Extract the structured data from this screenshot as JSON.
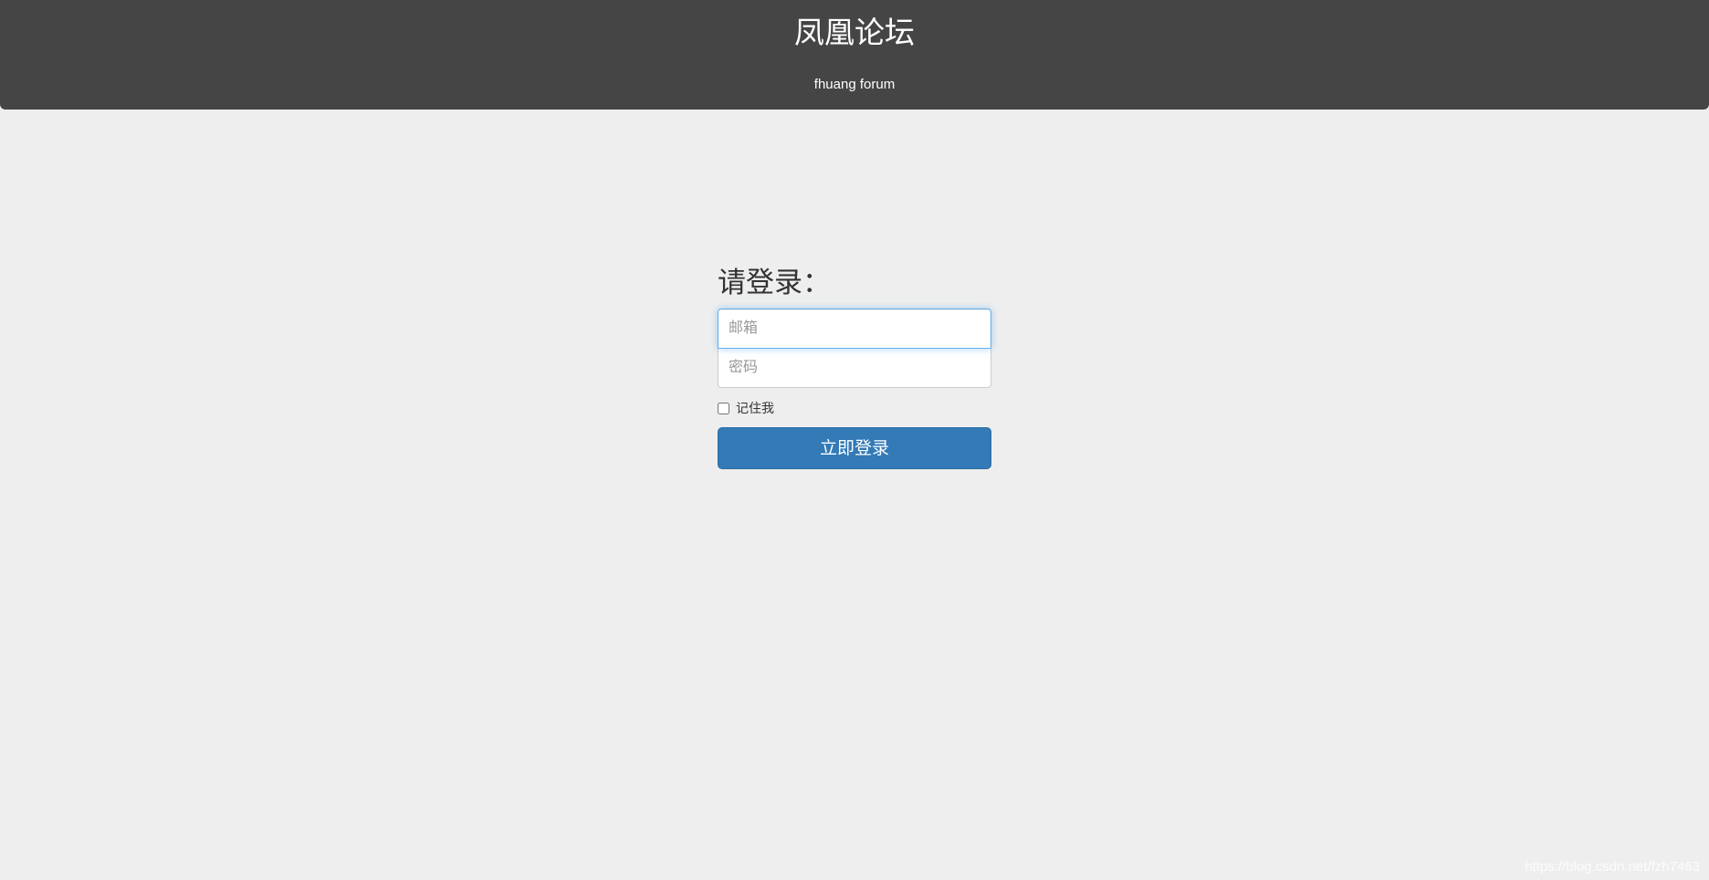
{
  "header": {
    "title": "凤凰论坛",
    "subtitle": "fhuang forum"
  },
  "login": {
    "heading": "请登录：",
    "email_placeholder": "邮箱",
    "password_placeholder": "密码",
    "remember_label": "记住我",
    "remember_checked": false,
    "submit_label": "立即登录"
  },
  "watermark": "https://blog.csdn.net/fzh7463",
  "colors": {
    "header_bg": "#454545",
    "page_bg": "#eeeeee",
    "primary_button": "#337ab7",
    "focus_border": "#66afe9"
  }
}
